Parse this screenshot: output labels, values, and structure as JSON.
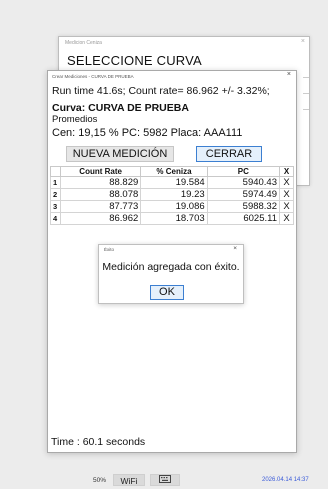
{
  "back_window": {
    "title": "Medicion Ceniza",
    "heading": "SELECCIONE CURVA",
    "close": "×"
  },
  "main_window": {
    "title": "Crear Mediciones - CURVA DE PRUEBA",
    "close": "×",
    "runtime": "Run time 41.6s; Count rate= 86.962 +/- 3.32%;",
    "curva": "Curva: CURVA DE PRUEBA",
    "promedios": "Promedios",
    "stats": "Cen: 19,15 %   PC: 5982   Placa: AAA111",
    "btn_nueva": "NUEVA MEDICIÓN",
    "btn_cerrar": "CERRAR",
    "time_footer": "Time : 60.1 seconds"
  },
  "table": {
    "headers": [
      "",
      "Count Rate",
      "% Ceniza",
      "PC",
      "X"
    ],
    "rows": [
      {
        "n": "1",
        "count_rate": "88.829",
        "ceniza": "19.584",
        "pc": "5940.43",
        "x": "X"
      },
      {
        "n": "2",
        "count_rate": "88.078",
        "ceniza": "19.23",
        "pc": "5974.49",
        "x": "X"
      },
      {
        "n": "3",
        "count_rate": "87.773",
        "ceniza": "19.086",
        "pc": "5988.32",
        "x": "X"
      },
      {
        "n": "4",
        "count_rate": "86.962",
        "ceniza": "18.703",
        "pc": "6025.11",
        "x": "X"
      }
    ]
  },
  "dialog": {
    "title": "Éxito",
    "close": "×",
    "message": "Medición agregada con éxito.",
    "ok": "OK"
  },
  "taskbar": {
    "zoom": "50%",
    "wifi": "WiFi",
    "keyboard_icon": "keyboard-icon",
    "clock": "2026.04.14 14:37"
  },
  "colors": {
    "accent_border": "#3c7fd1",
    "clock_text": "#3a5bd9"
  }
}
